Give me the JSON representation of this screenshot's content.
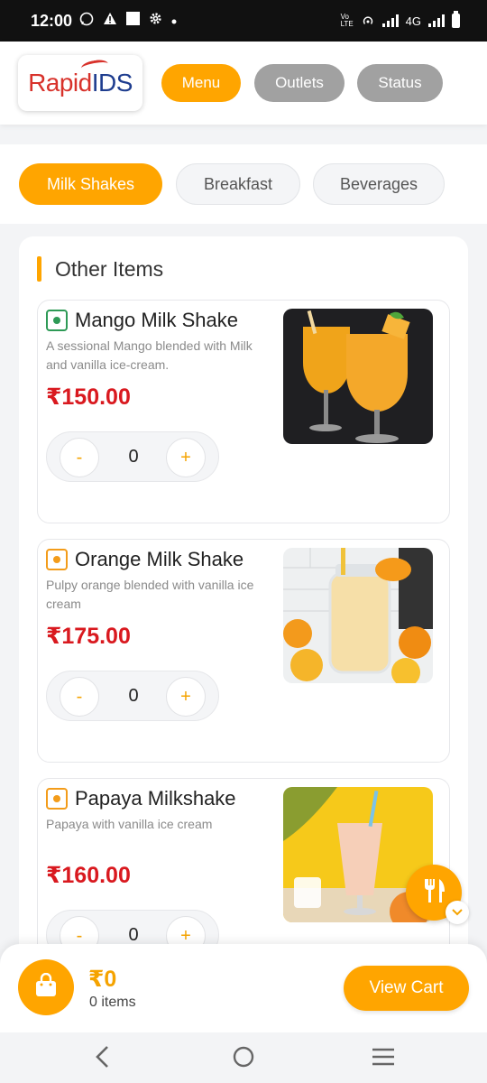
{
  "status_bar": {
    "time": "12:00",
    "network": "4G"
  },
  "header": {
    "logo_part1": "Rapid",
    "logo_part2": "IDS",
    "nav": [
      {
        "label": "Menu",
        "active": true
      },
      {
        "label": "Outlets",
        "active": false
      },
      {
        "label": "Status",
        "active": false
      }
    ]
  },
  "categories": [
    {
      "label": "Milk Shakes",
      "active": true
    },
    {
      "label": "Breakfast",
      "active": false
    },
    {
      "label": "Beverages",
      "active": false
    }
  ],
  "section": {
    "title": "Other Items"
  },
  "items": [
    {
      "name": "Mango Milk Shake",
      "description": "A sessional Mango blended with Milk and vanilla ice-cream.",
      "price": "₹150.00",
      "quantity": "0",
      "indicator_color": "#2e9a56"
    },
    {
      "name": "Orange Milk Shake",
      "description": "Pulpy orange blended with vanilla ice cream",
      "price": "₹175.00",
      "quantity": "0",
      "indicator_color": "#f39c1a"
    },
    {
      "name": "Papaya Milkshake",
      "description": "Papaya with vanilla ice cream",
      "price": "₹160.00",
      "quantity": "0",
      "indicator_color": "#f39c1a"
    }
  ],
  "stepper": {
    "minus": "-",
    "plus": "+"
  },
  "cart": {
    "total": "₹0",
    "items_label": "0 items",
    "button_label": "View Cart"
  },
  "colors": {
    "accent": "#ffa500",
    "price": "#d9191f",
    "inactive_nav": "#a1a1a1"
  }
}
